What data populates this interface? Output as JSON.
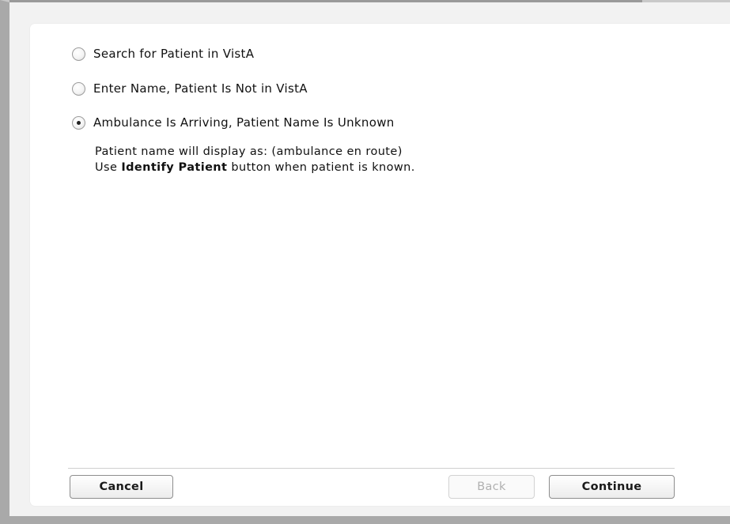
{
  "options": [
    {
      "label": "Search for Patient in VistA",
      "checked": false
    },
    {
      "label": "Enter Name, Patient Is Not in VistA",
      "checked": false
    },
    {
      "label": "Ambulance Is Arriving, Patient Name Is Unknown",
      "checked": true
    }
  ],
  "info": {
    "line1": "Patient name will display as:  (ambulance en route)",
    "line2_prefix": "Use ",
    "line2_bold": "Identify Patient",
    "line2_suffix": " button when patient is known."
  },
  "buttons": {
    "cancel": "Cancel",
    "back": "Back",
    "continue": "Continue"
  }
}
